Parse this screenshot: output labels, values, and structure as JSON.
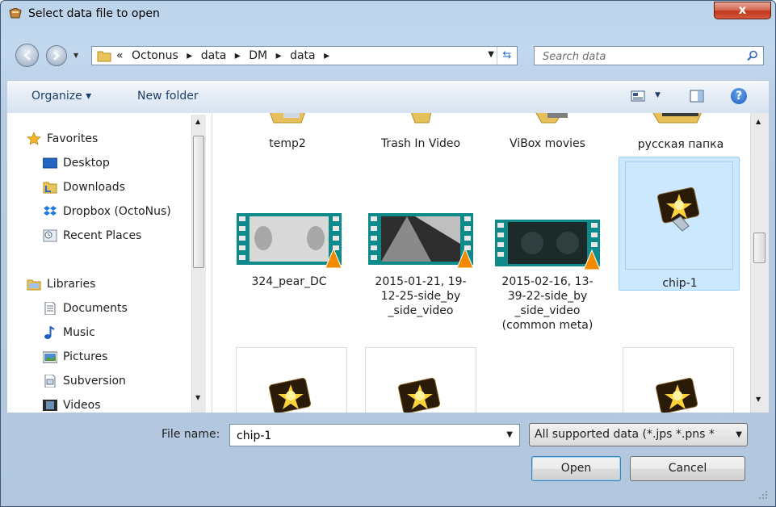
{
  "window": {
    "title": "Select data file to open",
    "close_label": "x"
  },
  "address": {
    "segments": [
      "«",
      "Octonus",
      "▸",
      "data",
      "▸",
      "DM",
      "▸",
      "data",
      "▸"
    ]
  },
  "search": {
    "placeholder": "Search data"
  },
  "toolbar": {
    "organize_label": "Organize ▾",
    "new_folder_label": "New folder",
    "help_label": "?"
  },
  "nav": {
    "favorites": "Favorites",
    "favorites_items": [
      "Desktop",
      "Downloads",
      "Dropbox (OctoNus)",
      "Recent Places"
    ],
    "libraries": "Libraries",
    "libraries_items": [
      "Documents",
      "Music",
      "Pictures",
      "Subversion",
      "Videos"
    ]
  },
  "files": {
    "row1": [
      "temp2",
      "Trash In Video",
      "ViBox movies",
      "русская папка"
    ],
    "row2": [
      {
        "name": "324_pear_DC"
      },
      {
        "name": "2015-01-21, 19-12-25-side_by _side_video"
      },
      {
        "name": "2015-02-16, 13-39-22-side_by _side_video (common meta)"
      },
      {
        "name": "chip-1",
        "selected": true
      }
    ]
  },
  "bottom": {
    "file_name_label": "File name:",
    "file_name_value": "chip-1",
    "filter_label": "All supported data (*.jps *.pns *",
    "open_label": "Open",
    "cancel_label": "Cancel"
  },
  "colors": {
    "selection": "#cce8ff",
    "selection_border": "#99d1ff",
    "accent": "#1e3f66"
  }
}
